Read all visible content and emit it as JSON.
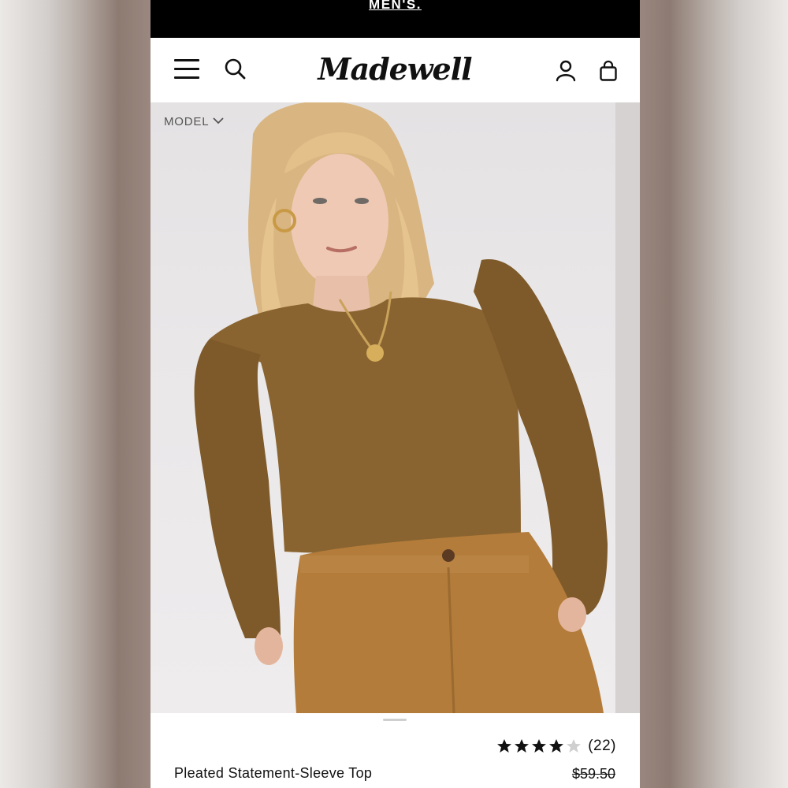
{
  "promo": {
    "link_label": "MEN'S."
  },
  "header": {
    "brand_logo_text": "Madewell",
    "icons": [
      "menu-icon",
      "search-icon",
      "account-icon",
      "bag-icon"
    ]
  },
  "gallery": {
    "view_toggle_label": "MODEL",
    "toggle_icon": "chevron-down-icon"
  },
  "product": {
    "name": "Pleated Statement-Sleeve Top",
    "original_price": "$59.50",
    "rating": {
      "stars_filled": 4,
      "stars_total": 5,
      "review_count_label": "(22)"
    }
  },
  "colors": {
    "promo_bar": "#000000",
    "text": "#111111",
    "star_filled": "#111111",
    "star_empty": "#cfcfcf"
  }
}
